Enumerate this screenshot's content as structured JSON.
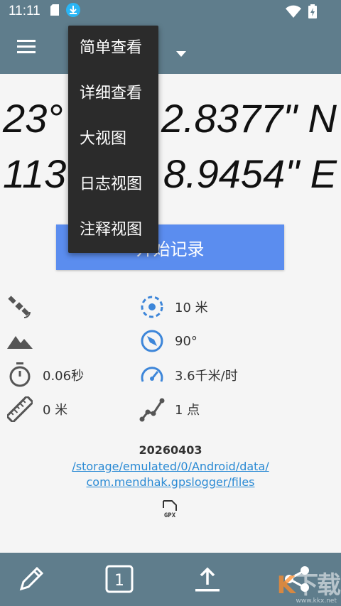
{
  "status_bar": {
    "time": "11:11"
  },
  "coordinates": {
    "lat_left": "23°",
    "lat_right": "2.8377\" N",
    "lon_left": "113",
    "lon_right": "8.9454\" E"
  },
  "menu": {
    "items": [
      "简单查看",
      "详细查看",
      "大视图",
      "日志视图",
      "注释视图"
    ]
  },
  "start_button": {
    "label": "开始记录"
  },
  "stats": {
    "accuracy": "10 米",
    "bearing": "90°",
    "duration": "0.06秒",
    "speed": "3.6千米/时",
    "distance": "0 米",
    "points": "1 点"
  },
  "log_info": {
    "date": "20260403",
    "path_line1": "/storage/emulated/0/Android/data/",
    "path_line2": "com.mendhak.gpslogger/files"
  },
  "gpx_icon_label": "GPX",
  "bottom_bar": {
    "page_number": "1"
  },
  "watermark": {
    "main_accent": "K",
    "main_rest": "下载",
    "sub": "www.kkx.net"
  },
  "colors": {
    "appbar": "#5f7d8c",
    "accent_blue": "#5b8def",
    "menu_bg": "#2b2b2b",
    "link": "#2a8ad4",
    "icon_blue": "#3d86d9"
  }
}
